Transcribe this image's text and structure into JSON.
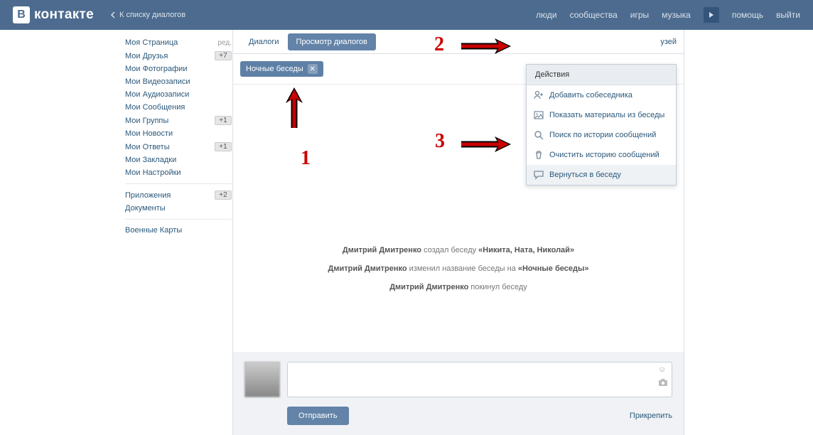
{
  "header": {
    "logo_letter": "В",
    "logo_text": "контакте",
    "back": "К списку диалогов",
    "nav": {
      "people": "люди",
      "communities": "сообщества",
      "games": "игры",
      "music": "музыка",
      "help": "помощь",
      "logout": "выйти"
    }
  },
  "sidebar": {
    "edit_label": "ред.",
    "items": [
      {
        "label": "Моя Страница",
        "badge": null,
        "edit": true
      },
      {
        "label": "Мои Друзья",
        "badge": "+7"
      },
      {
        "label": "Мои Фотографии"
      },
      {
        "label": "Мои Видеозаписи"
      },
      {
        "label": "Мои Аудиозаписи"
      },
      {
        "label": "Мои Сообщения"
      },
      {
        "label": "Мои Группы",
        "badge": "+1"
      },
      {
        "label": "Мои Новости"
      },
      {
        "label": "Мои Ответы",
        "badge": "+1"
      },
      {
        "label": "Мои Закладки"
      },
      {
        "label": "Мои Настройки"
      }
    ],
    "group2": [
      {
        "label": "Приложения",
        "badge": "+2"
      },
      {
        "label": "Документы"
      }
    ],
    "group3": [
      {
        "label": "Военные Карты"
      }
    ]
  },
  "tabs": {
    "dialogs": "Диалоги",
    "view": "Просмотр диалогов",
    "right": "узей"
  },
  "chip": {
    "label": "Ночные беседы"
  },
  "dropdown": {
    "head": "Действия",
    "items": [
      {
        "icon": "user-plus",
        "label": "Добавить собеседника"
      },
      {
        "icon": "image",
        "label": "Показать материалы из беседы"
      },
      {
        "icon": "search",
        "label": "Поиск по истории сообщений"
      },
      {
        "icon": "trash",
        "label": "Очистить историю сообщений"
      },
      {
        "icon": "chat",
        "label": "Вернуться в беседу",
        "selected": true
      }
    ]
  },
  "log": {
    "l1_name": "Дмитрий Дмитренко",
    "l1_mid": " создал беседу ",
    "l1_quoted": "«Никита, Ната, Николай»",
    "l2_name": "Дмитрий Дмитренко",
    "l2_mid": " изменил название беседы на ",
    "l2_quoted": "«Ночные беседы»",
    "l3_name": "Дмитрий Дмитренко",
    "l3_mid": " покинул беседу"
  },
  "composer": {
    "send": "Отправить",
    "attach": "Прикрепить",
    "placeholder": ""
  },
  "annotations": {
    "n1": "1",
    "n2": "2",
    "n3": "3"
  }
}
